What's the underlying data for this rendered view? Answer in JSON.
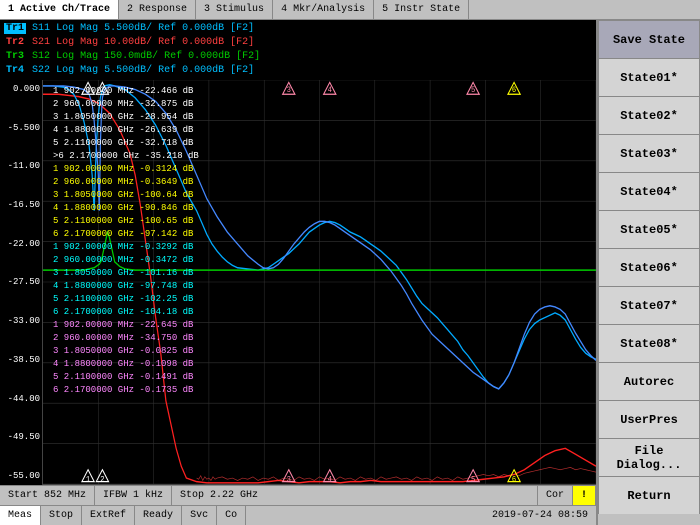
{
  "tabs": [
    {
      "id": 1,
      "label": "1 Active Ch/Trace",
      "active": true
    },
    {
      "id": 2,
      "label": "2 Response"
    },
    {
      "id": 3,
      "label": "3 Stimulus"
    },
    {
      "id": 4,
      "label": "4 Mkr/Analysis"
    },
    {
      "id": 5,
      "label": "5 Instr State"
    }
  ],
  "traces": [
    {
      "id": "Tr1",
      "param": "S11",
      "scale": "Log Mag",
      "db_div": "5.500dB",
      "ref": "Ref 0.000dB",
      "fmt": "F2",
      "color": "cyan"
    },
    {
      "id": "Tr2",
      "param": "S21",
      "scale": "Log Mag",
      "db_div": "10.00dB",
      "ref": "Ref 0.000dB",
      "fmt": "F2",
      "color": "red"
    },
    {
      "id": "Tr3",
      "param": "S12",
      "scale": "Log Mag",
      "db_div": "150.0mdB",
      "ref": "Ref 0.000dB",
      "fmt": "F2",
      "color": "green"
    },
    {
      "id": "Tr4",
      "param": "S22",
      "scale": "Log Mag",
      "db_div": "5.500dB",
      "ref": "Ref 0.000dB",
      "fmt": "F2",
      "color": "cyan"
    }
  ],
  "y_axis": {
    "values": [
      "0.000",
      "-5.500",
      "-11.00",
      "-16.50",
      "-22.00",
      "-27.50",
      "-33.00",
      "-38.50",
      "-44.00",
      "-49.50",
      "-55.00"
    ]
  },
  "marker_data": {
    "group1": {
      "color": "white",
      "entries": [
        "1  902.00000 MHz  -22.466 dB",
        "2  960.00000 MHz  -32.875 dB",
        "3  1.8050000 GHz  -28.954 dB",
        "4  1.8800000 GHz  -26.639 dB",
        "5  2.1100000 GHz  -32.718 dB",
        ">6  2.1700000 GHz  -35.218 dB"
      ]
    },
    "group2": {
      "color": "yellow",
      "entries": [
        "1  902.00000 MHz  -0.3124 dB",
        "2  960.00000 MHz  -0.3649 dB",
        "3  1.8050000 GHz  -100.64 dB",
        "4  1.8800000 GHz  -90.846 dB",
        "5  2.1100000 GHz  -100.65 dB",
        "6  2.1700000 GHz  -97.142 dB"
      ]
    },
    "group3": {
      "color": "cyan",
      "entries": [
        "1  902.00000 MHz  -0.3292 dB",
        "2  960.00000 MHz  -0.3472 dB",
        "3  1.8050000 GHz  -101.16 dB",
        "4  1.8800000 GHz  -97.748 dB",
        "5  2.1100000 GHz  -102.25 dB",
        "6  2.1700000 GHz  -104.18 dB"
      ]
    },
    "group4": {
      "color": "pink",
      "entries": [
        "1  902.00000 MHz  -22.645 dB",
        "2  960.00000 MHz  -34.750 dB",
        "3  1.8050000 GHz  -0.0825 dB",
        "4  1.8800000 GHz  -0.1098 dB",
        "5  2.1100000 GHz  -0.1491 dB",
        "6  2.1700000 GHz  -0.1735 dB"
      ]
    }
  },
  "status": {
    "start": "Start 852 MHz",
    "ifbw": "IFBW 1 kHz",
    "stop": "Stop 2.22 GHz",
    "cor": "Cor"
  },
  "toolbar": {
    "meas": "Meas",
    "stop_btn": "Stop",
    "ext_ref": "ExtRef",
    "ready": "Ready",
    "svc": "Svc",
    "co": "Co",
    "datetime": "2019-07-24 08:59"
  },
  "sidebar": {
    "save_state": "Save State",
    "states": [
      "State01*",
      "State02*",
      "State03*",
      "State04*",
      "State05*",
      "State06*",
      "State07*",
      "State08*"
    ],
    "autorec": "Autorec",
    "user_pres": "UserPres",
    "file_dialog": "File Dialog...",
    "return": "Return"
  }
}
